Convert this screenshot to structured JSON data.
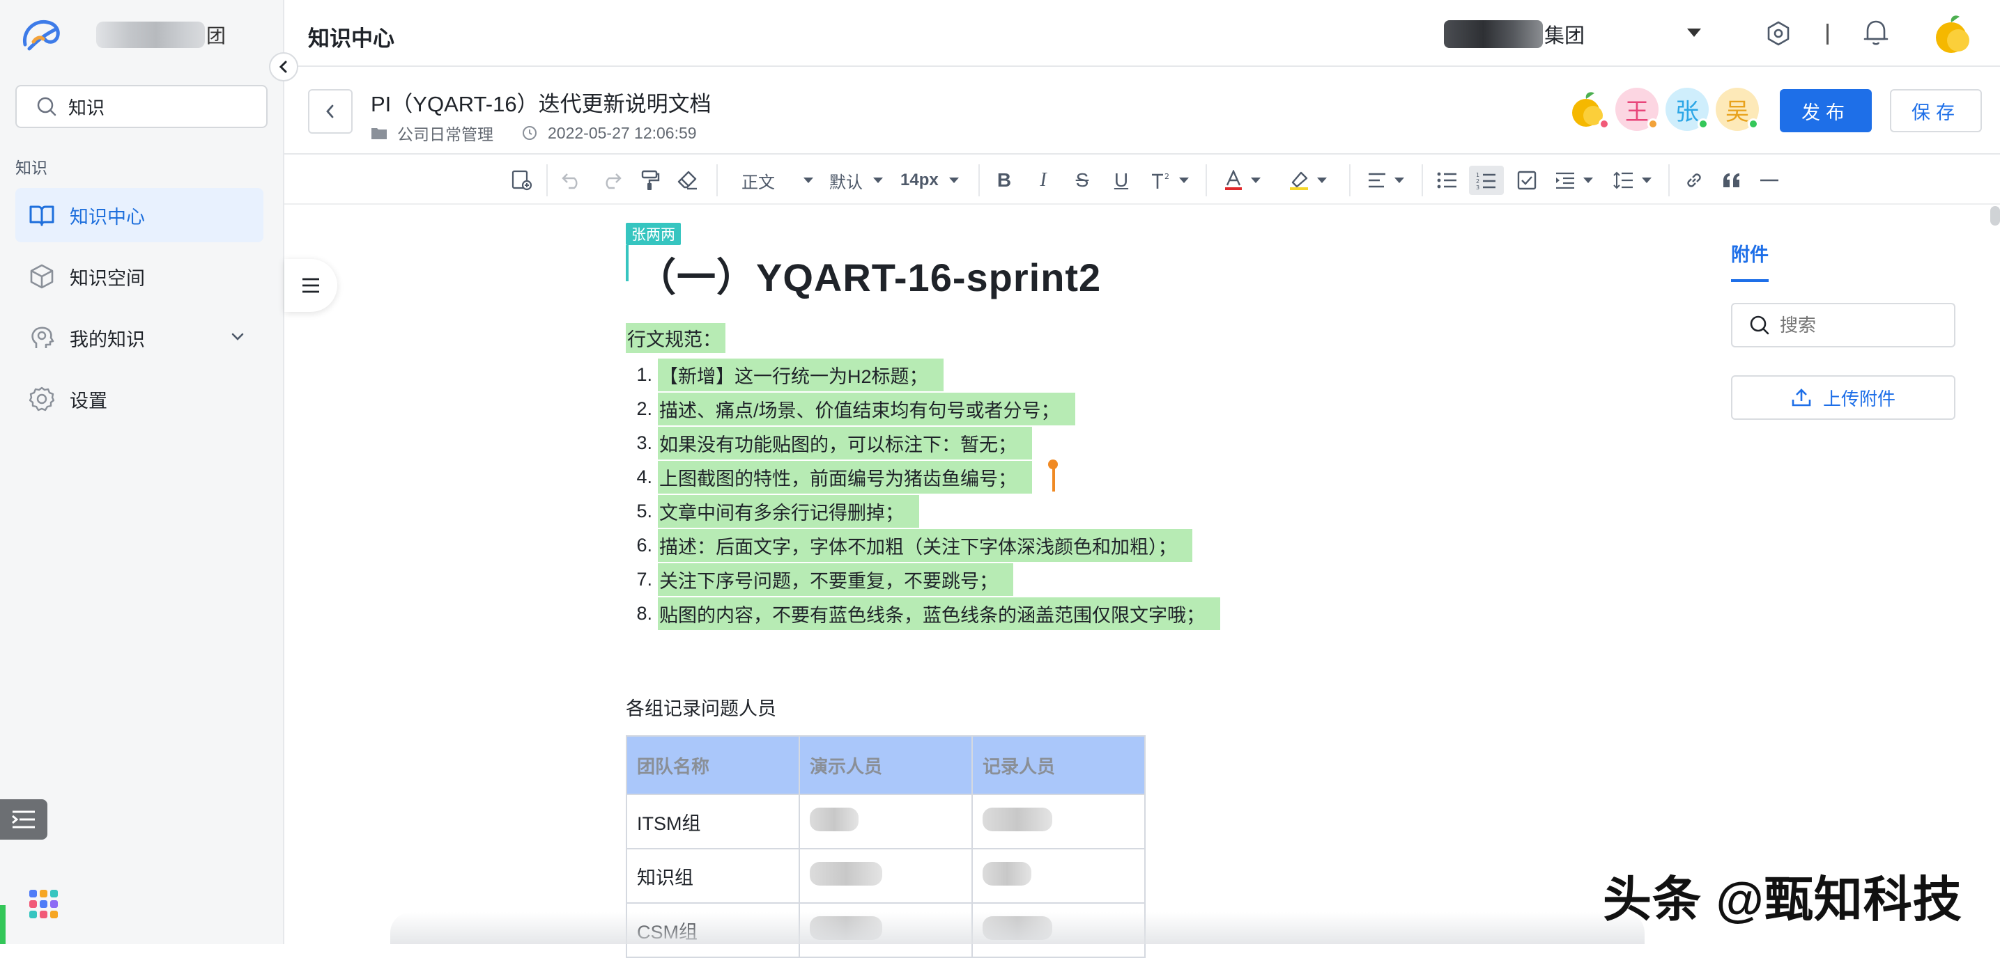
{
  "sidebar": {
    "org_suffix": "团",
    "search_value": "知识",
    "section_label": "知识",
    "items": [
      {
        "label": "知识中心",
        "icon": "book-icon",
        "active": true
      },
      {
        "label": "知识空间",
        "icon": "cube-icon",
        "active": false
      },
      {
        "label": "我的知识",
        "icon": "head-idea-icon",
        "active": false
      },
      {
        "label": "设置",
        "icon": "gear-icon",
        "active": false
      }
    ]
  },
  "topbar": {
    "title": "知识中心",
    "company_suffix": "集团"
  },
  "doc": {
    "title": "PI（YQART-16）迭代更新说明文档",
    "space": "公司日常管理",
    "updated_at": "2022-05-27 12:06:59",
    "collaborators": [
      {
        "initial": "",
        "bg": "#ffffff",
        "dot": "#f15a78"
      },
      {
        "initial": "王",
        "bg": "#fcd6e2",
        "color": "#e8457a",
        "dot": "#f2a23a"
      },
      {
        "initial": "张",
        "bg": "#cfeefc",
        "color": "#2ba6e6",
        "dot": "#34c759"
      },
      {
        "initial": "吴",
        "bg": "#fde9b8",
        "color": "#e8a21c",
        "dot": "#34c759"
      }
    ],
    "publish_label": "发布",
    "save_label": "保存"
  },
  "toolbar": {
    "paragraph_style": "正文",
    "font": "默认",
    "font_size": "14px"
  },
  "editor": {
    "author_tag": "张两两",
    "heading": "（一）YQART-16-sprint2",
    "rules_title": "行文规范：",
    "rules": [
      "【新增】这一行统一为H2标题；",
      "描述、痛点/场景、价值结束均有句号或者分号；",
      "如果没有功能贴图的，可以标注下：暂无；",
      "上图截图的特性，前面编号为猪齿鱼编号；",
      "文章中间有多余行记得删掉；",
      "描述：后面文字，字体不加粗（关注下字体深浅颜色和加粗）；",
      "关注下序号问题，不要重复，不要跳号；",
      "贴图的内容，不要有蓝色线条，蓝色线条的涵盖范围仅限文字哦；"
    ],
    "table_title": "各组记录问题人员",
    "table": {
      "headers": [
        "团队名称",
        "演示人员",
        "记录人员"
      ],
      "rows": [
        [
          "ITSM组",
          "",
          ""
        ],
        [
          "知识组",
          "",
          ""
        ],
        [
          "CSM组",
          "",
          ""
        ]
      ]
    }
  },
  "attachments": {
    "tab_label": "附件",
    "search_placeholder": "搜索",
    "upload_label": "上传附件"
  },
  "watermark": "头条 @甄知科技",
  "colors": {
    "accent": "#1e6fe8",
    "highlight": "#b7ebb4",
    "table_header": "#aac7fa",
    "author_tag": "#36c5c0"
  }
}
